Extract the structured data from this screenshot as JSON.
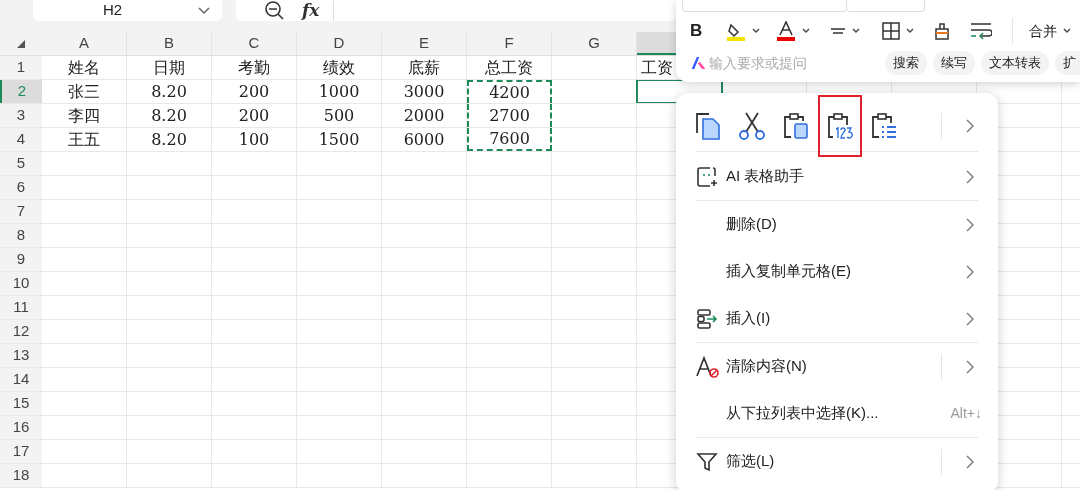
{
  "name_box": {
    "value": "H2"
  },
  "formula_bar": {
    "fx_label": "fx"
  },
  "sheet": {
    "columns": [
      {
        "label": "A",
        "selected": false
      },
      {
        "label": "B",
        "selected": false
      },
      {
        "label": "C",
        "selected": false
      },
      {
        "label": "D",
        "selected": false
      },
      {
        "label": "E",
        "selected": false
      },
      {
        "label": "F",
        "selected": false
      },
      {
        "label": "G",
        "selected": false
      },
      {
        "selected": true
      }
    ],
    "rows": [
      {
        "label": "1",
        "selected": false,
        "cells": [
          {
            "text": "姓名",
            "copied": false,
            "active": false
          },
          {
            "text": "日期",
            "copied": false,
            "active": false
          },
          {
            "text": "考勤",
            "copied": false,
            "active": false
          },
          {
            "text": "绩效",
            "copied": false,
            "active": false
          },
          {
            "text": "底薪",
            "copied": false,
            "active": false
          },
          {
            "text": "总工资",
            "copied": false,
            "active": false
          },
          {
            "copied": false,
            "active": false
          },
          {
            "text": "工资",
            "copied": false,
            "active": false
          }
        ]
      },
      {
        "label": "2",
        "selected": true,
        "cells": [
          {
            "text": "张三",
            "copied": false,
            "active": false
          },
          {
            "text": "8.20",
            "copied": false,
            "active": false
          },
          {
            "text": "200",
            "copied": false,
            "active": false
          },
          {
            "text": "1000",
            "copied": false,
            "active": false
          },
          {
            "text": "3000",
            "copied": false,
            "active": false
          },
          {
            "text": "4200",
            "copied": true,
            "active": false
          },
          {
            "copied": false,
            "active": false
          },
          {
            "copied": false,
            "active": true
          }
        ]
      },
      {
        "label": "3",
        "selected": false,
        "cells": [
          {
            "text": "李四",
            "copied": false,
            "active": false
          },
          {
            "text": "8.20",
            "copied": false,
            "active": false
          },
          {
            "text": "200",
            "copied": false,
            "active": false
          },
          {
            "text": "500",
            "copied": false,
            "active": false
          },
          {
            "text": "2000",
            "copied": false,
            "active": false
          },
          {
            "text": "2700",
            "copied": true,
            "active": false
          },
          {
            "copied": false,
            "active": false
          },
          {
            "copied": false,
            "active": false
          }
        ]
      },
      {
        "label": "4",
        "selected": false,
        "cells": [
          {
            "text": "王五",
            "copied": false,
            "active": false
          },
          {
            "text": "8.20",
            "copied": false,
            "active": false
          },
          {
            "text": "100",
            "copied": false,
            "active": false
          },
          {
            "text": "1500",
            "copied": false,
            "active": false
          },
          {
            "text": "6000",
            "copied": false,
            "active": false
          },
          {
            "text": "7600",
            "copied": true,
            "active": false
          },
          {
            "copied": false,
            "active": false
          },
          {
            "copied": false,
            "active": false
          }
        ]
      },
      {
        "label": "5",
        "selected": false
      },
      {
        "label": "6",
        "selected": false
      },
      {
        "label": "7",
        "selected": false
      },
      {
        "label": "8",
        "selected": false
      },
      {
        "label": "9",
        "selected": false
      },
      {
        "label": "10",
        "selected": false
      },
      {
        "label": "11",
        "selected": false
      },
      {
        "label": "12",
        "selected": false
      },
      {
        "label": "13",
        "selected": false
      },
      {
        "label": "14",
        "selected": false
      },
      {
        "label": "15",
        "selected": false
      },
      {
        "label": "16",
        "selected": false
      },
      {
        "label": "17",
        "selected": false
      },
      {
        "label": "18",
        "selected": false
      }
    ]
  },
  "format_toolbar": {
    "buttons": [
      {
        "kind": "bold",
        "label": "B"
      },
      {
        "kind": "fill"
      },
      {
        "kind": "font_color"
      },
      {
        "kind": "align"
      },
      {
        "kind": "border"
      },
      {
        "kind": "clear_format"
      },
      {
        "kind": "wrap"
      }
    ],
    "merge": "合并",
    "ai_bar": {
      "placeholder": "输入要求或提问",
      "chips": [
        "搜索",
        "续写",
        "文本转表",
        "扩"
      ]
    }
  },
  "context_menu": {
    "quick_actions": [
      {
        "kind": "copy",
        "selected": false
      },
      {
        "kind": "cut",
        "selected": false
      },
      {
        "kind": "paste",
        "selected": false
      },
      {
        "kind": "paste_values",
        "selected": true
      },
      {
        "kind": "paste_list",
        "selected": false
      }
    ],
    "groups": [
      [
        {
          "kind": "ai",
          "label": "AI 表格助手",
          "submenu": true,
          "split": false
        }
      ],
      [
        {
          "kind": "plain",
          "label": "删除(D)",
          "submenu": true,
          "split": false
        },
        {
          "kind": "plain",
          "label": "插入复制单元格(E)",
          "submenu": true,
          "split": false
        },
        {
          "kind": "insert",
          "label": "插入(I)",
          "submenu": true,
          "split": false
        }
      ],
      [
        {
          "kind": "clear",
          "label": "清除内容(N)",
          "submenu": true,
          "split": true
        },
        {
          "kind": "plain",
          "label": "从下拉列表中选择(K)...",
          "shortcut": "Alt+↓",
          "submenu": false,
          "split": false
        }
      ],
      [
        {
          "kind": "filter",
          "label": "筛选(L)",
          "submenu": true,
          "split": true
        }
      ]
    ]
  }
}
